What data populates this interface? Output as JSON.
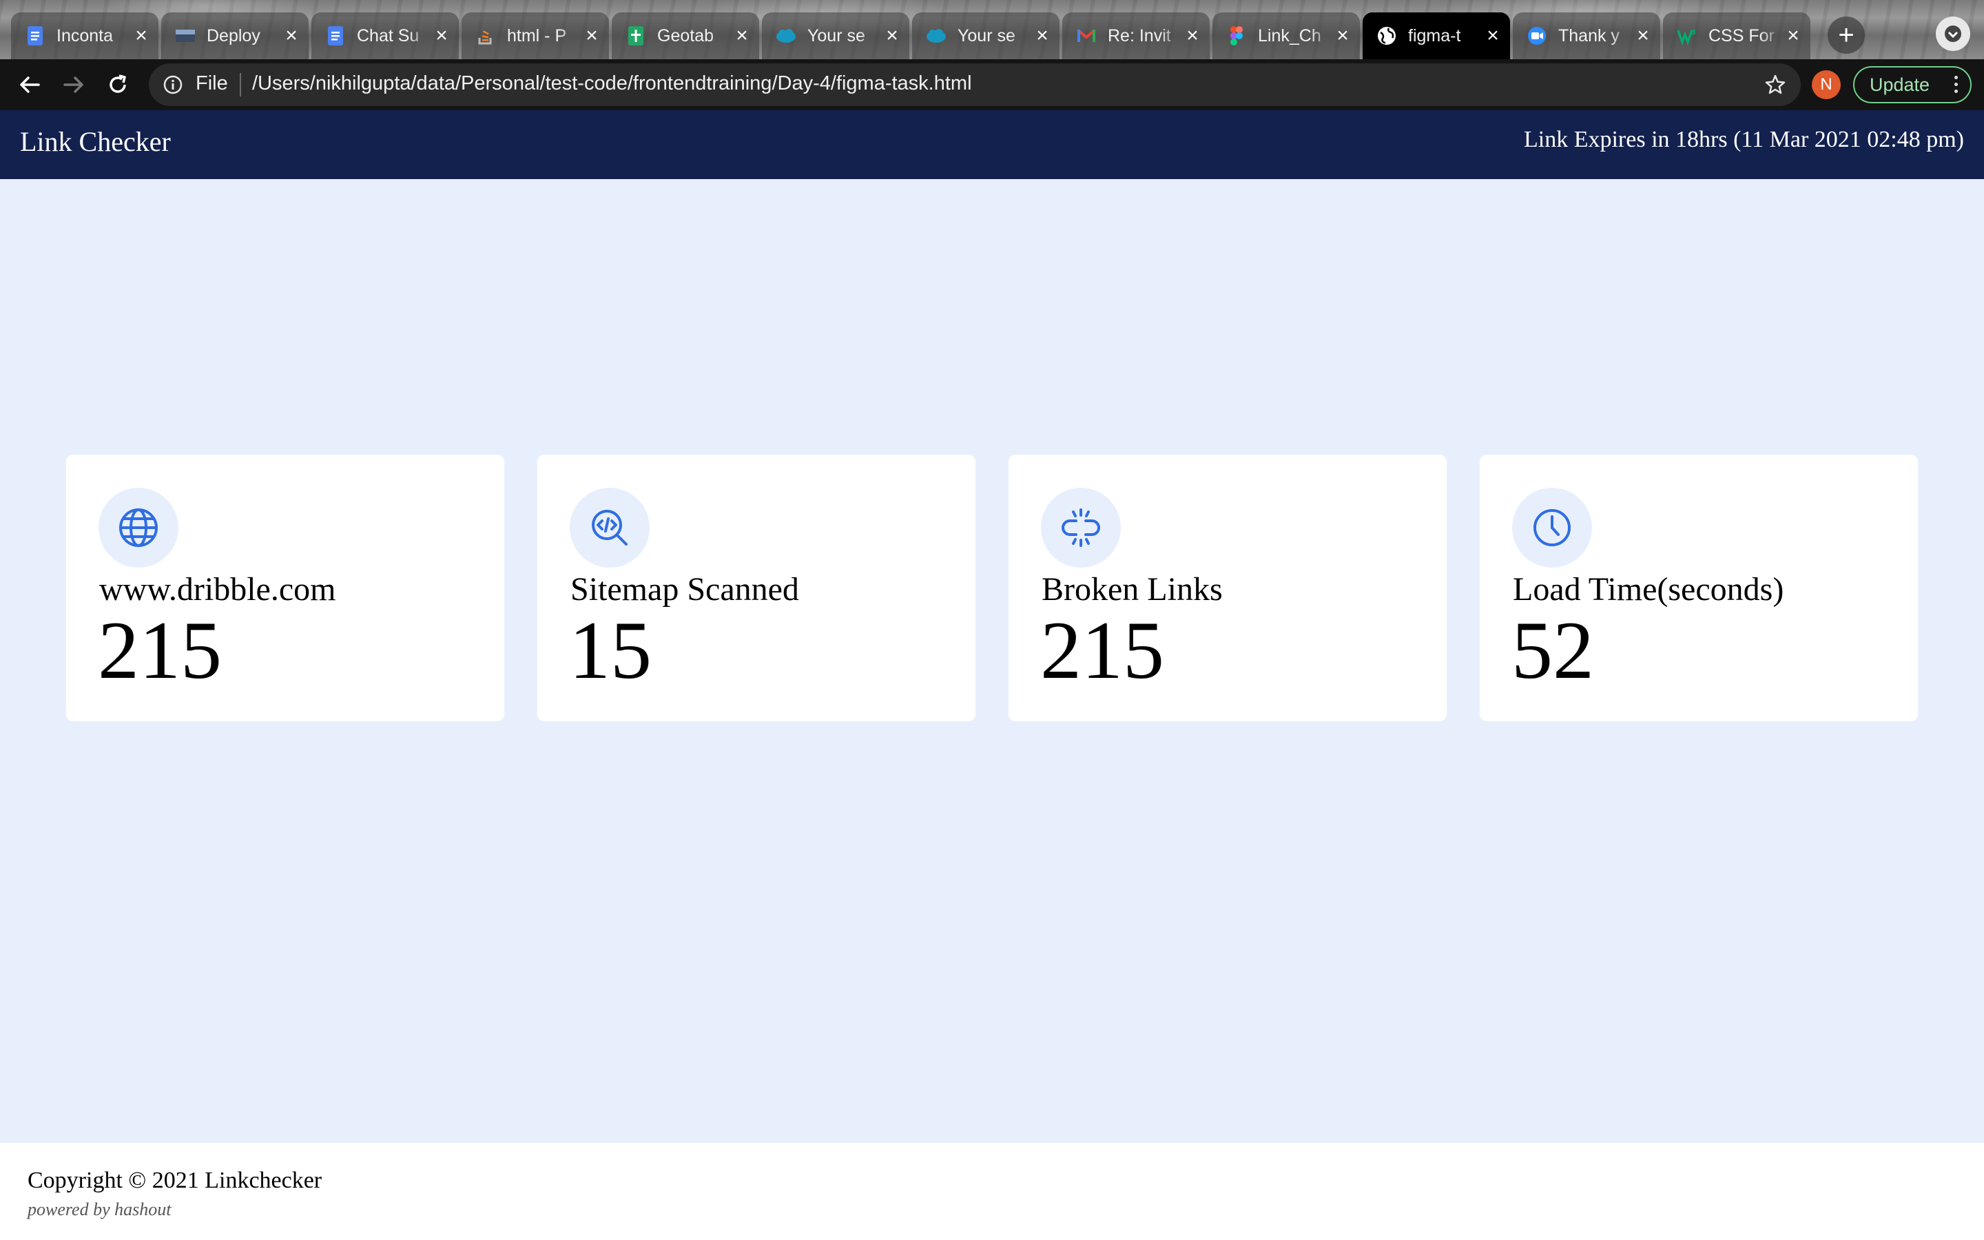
{
  "browser": {
    "tabs": [
      {
        "title": "Inconta",
        "favicon": "docs-icon",
        "color": "#4a80f0",
        "active": false
      },
      {
        "title": "Deploy",
        "favicon": "image-thumbnail-icon",
        "color": "#3b4a63",
        "active": false
      },
      {
        "title": "Chat Su",
        "favicon": "docs-icon",
        "color": "#4a80f0",
        "active": false
      },
      {
        "title": "html - P",
        "favicon": "stackoverflow-icon",
        "color": "#f48024",
        "active": false
      },
      {
        "title": "Geotab",
        "favicon": "sheets-icon",
        "color": "#23a566",
        "active": false
      },
      {
        "title": "Your se",
        "favicon": "salesforce-icon",
        "color": "#1798c1",
        "active": false
      },
      {
        "title": "Your se",
        "favicon": "salesforce-icon",
        "color": "#1798c1",
        "active": false
      },
      {
        "title": "Re: Invit",
        "favicon": "gmail-icon",
        "color": "#ea4335",
        "active": false
      },
      {
        "title": "Link_Ch",
        "favicon": "figma-icon",
        "color": "#a259ff",
        "active": false
      },
      {
        "title": "figma-t",
        "favicon": "globe-icon",
        "color": "#ffffff",
        "active": true
      },
      {
        "title": "Thank y",
        "favicon": "zoom-icon",
        "color": "#2d8cff",
        "active": false
      },
      {
        "title": "CSS For",
        "favicon": "w3schools-icon",
        "color": "#04aa6d",
        "active": false
      }
    ],
    "address": {
      "scheme": "File",
      "url": "/Users/nikhilgupta/data/Personal/test-code/frontendtraining/Day-4/figma-task.html"
    },
    "profile_initial": "N",
    "profile_color": "#e05a2b",
    "update_label": "Update"
  },
  "header": {
    "title": "Link Checker",
    "expiry": "Link Expires in 18hrs (11 Mar 2021 02:48 pm)",
    "background": "#13214f"
  },
  "cards": [
    {
      "icon": "globe-icon",
      "label": "www.dribble.com",
      "value": "215"
    },
    {
      "icon": "search-code-icon",
      "label": "Sitemap Scanned",
      "value": "15"
    },
    {
      "icon": "broken-link-icon",
      "label": "Broken Links",
      "value": "215"
    },
    {
      "icon": "clock-icon",
      "label": "Load Time(seconds)",
      "value": "52"
    }
  ],
  "footer": {
    "copyright": "Copyright © 2021 Linkchecker",
    "powered": "powered by hashout"
  },
  "colors": {
    "page_bg": "#e8effc",
    "accent": "#2f6ee0"
  }
}
